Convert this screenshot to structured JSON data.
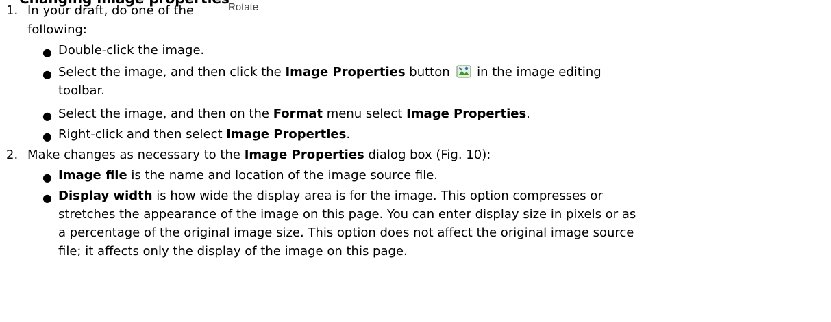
{
  "heading_fragment": "Changing image properties",
  "rotate_label": "Rotate",
  "steps": [
    {
      "number": "1.",
      "line1": "In your draft, do one of the",
      "line2": "following:",
      "bullets": [
        {
          "text": "Double-click the image."
        },
        {
          "pre": "Select the image, and then click the ",
          "bold": "Image Properties",
          "mid": " button ",
          "icon": "image-properties-icon",
          "post": " in the image editing",
          "cont": "toolbar."
        },
        {
          "pre": "Select the image, and then on the ",
          "bold": "Format",
          "mid": " menu select ",
          "bold2": "Image Properties",
          "post": "."
        },
        {
          "pre": "Right-click and then select ",
          "bold": "Image Properties",
          "post": "."
        }
      ]
    },
    {
      "number": "2.",
      "pre": "Make changes as necessary to the ",
      "bold": "Image Properties",
      "post": " dialog box (Fig. 10):",
      "bullets": [
        {
          "bold": "Image file",
          "post": " is the name and location of the image source file."
        },
        {
          "bold": "Display width",
          "post": " is how wide the display area is for the image. This option compresses or",
          "cont1": "stretches the appearance of the image on this page. You can enter display size in pixels or as",
          "cont2": "a percentage of the original image size. This option does not affect the original image source",
          "cont3": "file; it affects only the display of the image on this page."
        }
      ]
    }
  ],
  "colors": {
    "text": "#000000",
    "rotate_label": "#444444",
    "icon_green": "#3a9a2e",
    "icon_blue": "#2f6fb5"
  }
}
